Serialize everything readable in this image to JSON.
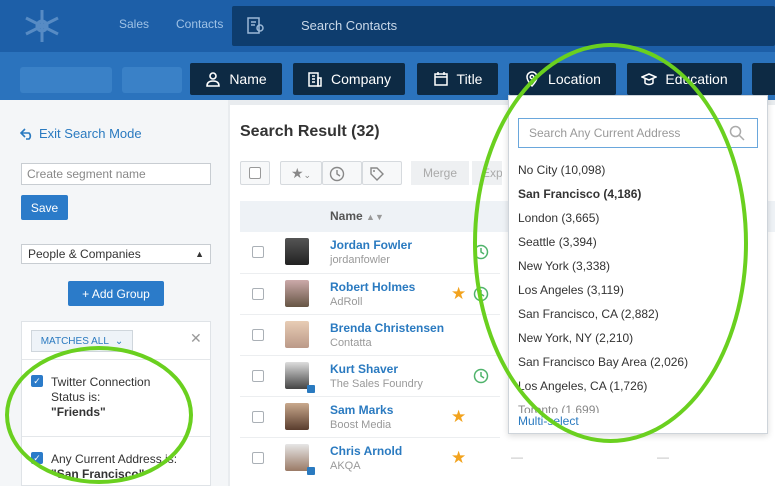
{
  "topbar": {
    "tabs_dim": [
      "Sales",
      "Contacts"
    ],
    "search_placeholder": "Search Contacts"
  },
  "filters": {
    "tabs": [
      "Name",
      "Company",
      "Title",
      "Location",
      "Education"
    ]
  },
  "left": {
    "exit_label": "Exit Search Mode",
    "segment_placeholder": "Create segment name",
    "save_label": "Save",
    "select_value": "People & Companies",
    "add_group_label": "+ Add Group",
    "matches_label": "MATCHES ALL",
    "conditions": [
      {
        "text": "Twitter Connection Status is:",
        "value": "\"Friends\""
      },
      {
        "text": "Any Current Address is:",
        "value": "\"San Francisco\""
      }
    ]
  },
  "results": {
    "title": "Search Result (32)",
    "merge_label": "Merge",
    "export_label": "Export",
    "name_header": "Name",
    "rows": [
      {
        "name": "Jordan Fowler",
        "sub": "jordanfowler",
        "star": false,
        "clock": true
      },
      {
        "name": "Robert Holmes",
        "sub": "AdRoll",
        "star": true,
        "clock": true
      },
      {
        "name": "Brenda Christensen",
        "sub": "Contatta",
        "star": false,
        "clock": false
      },
      {
        "name": "Kurt Shaver",
        "sub": "The Sales Foundry",
        "star": false,
        "clock": true
      },
      {
        "name": "Sam Marks",
        "sub": "Boost Media",
        "star": true,
        "clock": false
      },
      {
        "name": "Chris Arnold",
        "sub": "AKQA",
        "star": true,
        "clock": false
      }
    ]
  },
  "location_dropdown": {
    "search_placeholder": "Search Any Current Address",
    "options": [
      {
        "label": "No City (10,098)",
        "bold": false
      },
      {
        "label": "San Francisco (4,186)",
        "bold": true
      },
      {
        "label": "London (3,665)",
        "bold": false
      },
      {
        "label": "Seattle (3,394)",
        "bold": false
      },
      {
        "label": "New York (3,338)",
        "bold": false
      },
      {
        "label": "Los Angeles (3,119)",
        "bold": false
      },
      {
        "label": "San Francisco, CA (2,882)",
        "bold": false
      },
      {
        "label": "New York, NY (2,210)",
        "bold": false
      },
      {
        "label": "San Francisco Bay Area (2,026)",
        "bold": false
      },
      {
        "label": "Los Angeles, CA (1,726)",
        "bold": false
      },
      {
        "label": "Toronto (1,699)",
        "bold": false
      }
    ],
    "multi_select_label": "Multi-select"
  },
  "colors": {
    "accent": "#2b7bc9",
    "nav_dark": "#0d2a44",
    "annotation": "#6ad01f",
    "star": "#f2a31e"
  }
}
